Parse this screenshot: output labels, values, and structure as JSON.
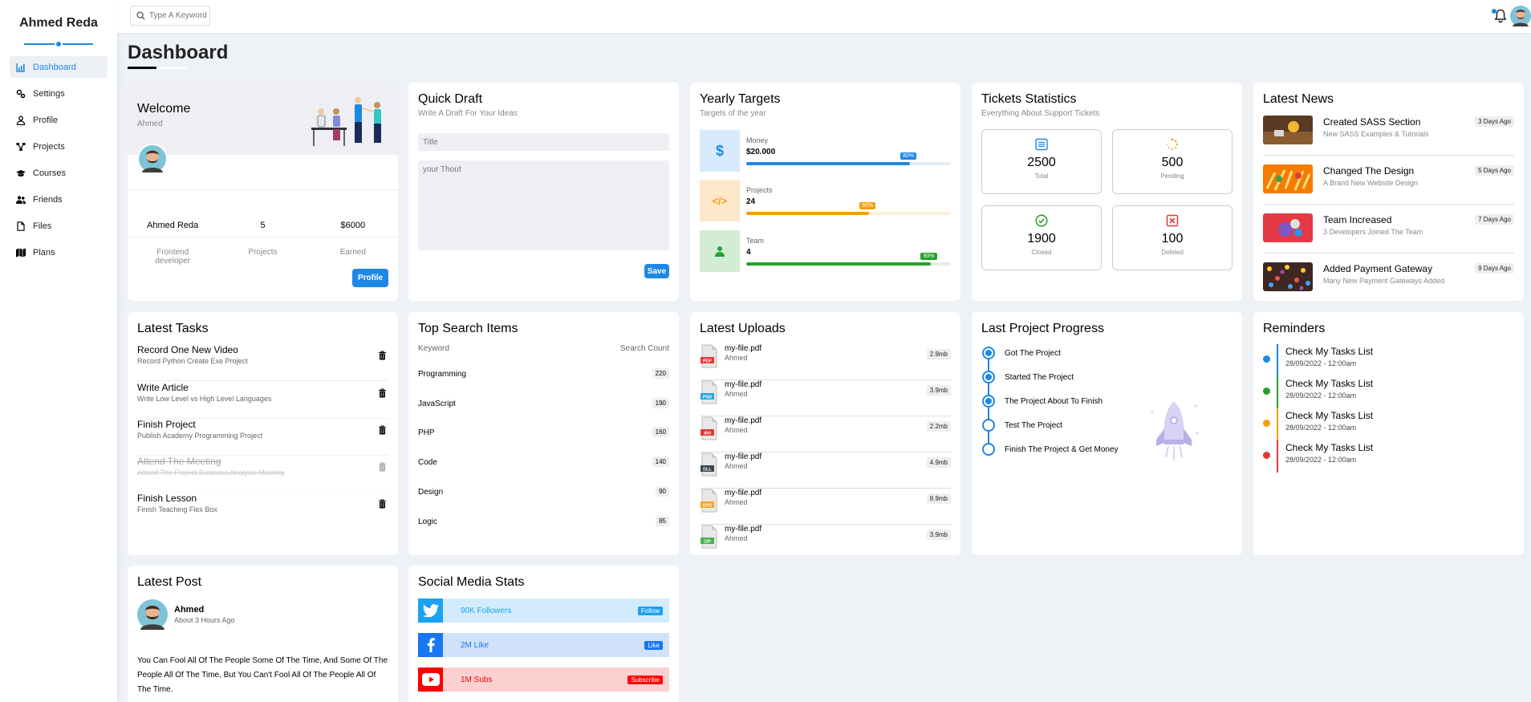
{
  "sidebar": {
    "brand": "Ahmed Reda",
    "items": [
      {
        "label": "Dashboard",
        "icon": "chart-icon"
      },
      {
        "label": "Settings",
        "icon": "gears-icon"
      },
      {
        "label": "Profile",
        "icon": "user-icon"
      },
      {
        "label": "Projects",
        "icon": "diagram-icon"
      },
      {
        "label": "Courses",
        "icon": "graduation-cap-icon"
      },
      {
        "label": "Friends",
        "icon": "users-icon"
      },
      {
        "label": "Files",
        "icon": "file-icon"
      },
      {
        "label": "Plans",
        "icon": "map-icon"
      }
    ]
  },
  "topbar": {
    "search_placeholder": "Type A Keyword"
  },
  "page": {
    "title": "Dashboard"
  },
  "welcome": {
    "title": "Welcome",
    "name": "Ahmed",
    "stats": [
      {
        "value": "Ahmed Reda",
        "label": "Frontend developer"
      },
      {
        "value": "5",
        "label": "Projects"
      },
      {
        "value": "$6000",
        "label": "Earned"
      }
    ],
    "button": "Profile"
  },
  "draft": {
    "title": "Quick Draft",
    "subtitle": "Write A Draft For Your Ideas",
    "title_placeholder": "Title",
    "body_placeholder": "your Thout",
    "button": "Save"
  },
  "targets": {
    "title": "Yearly Targets",
    "subtitle": "Targets of the year",
    "items": [
      {
        "label": "Money",
        "value": "$20.000",
        "percent": 80,
        "pct_label": "80%",
        "color": "#1e88e5",
        "bg": "#d8ebfc",
        "track": "#e3eef9"
      },
      {
        "label": "Projects",
        "value": "24",
        "percent": 60,
        "pct_label": "60%",
        "color": "#f59e0b",
        "bg": "#fde8cc",
        "track": "#fdf0da"
      },
      {
        "label": "Team",
        "value": "4",
        "percent": 90,
        "pct_label": "90%",
        "color": "#22a32c",
        "bg": "#d3ecd4",
        "track": "#e0f1e1"
      }
    ]
  },
  "tickets": {
    "title": "Tickets Statistics",
    "subtitle": "Everything About Support Tickets",
    "items": [
      {
        "value": "2500",
        "label": "Total"
      },
      {
        "value": "500",
        "label": "Pending"
      },
      {
        "value": "1900",
        "label": "Closed"
      },
      {
        "value": "100",
        "label": "Deleted"
      }
    ]
  },
  "news": {
    "title": "Latest News",
    "items": [
      {
        "title": "Created SASS Section",
        "desc": "New SASS Examples & Tutorials",
        "ago": "3 Days Ago"
      },
      {
        "title": "Changed The Design",
        "desc": "A Brand New Website Design",
        "ago": "5 Days Ago"
      },
      {
        "title": "Team Increased",
        "desc": "3 Developers Joined The Team",
        "ago": "7 Days Ago"
      },
      {
        "title": "Added Payment Gateway",
        "desc": "Many New Payment Gateways Added",
        "ago": "9 Days Ago"
      }
    ]
  },
  "tasks": {
    "title": "Latest Tasks",
    "items": [
      {
        "title": "Record One New Video",
        "desc": "Record Python Create Exe Project"
      },
      {
        "title": "Write Article",
        "desc": "Write Low Level vs High Level Languages"
      },
      {
        "title": "Finish Project",
        "desc": "Publish Academy Programming Project"
      },
      {
        "title": "Attend The Meeting",
        "desc": "Attend The Project Business Analysis Meeting"
      },
      {
        "title": "Finish Lesson",
        "desc": "Finish Teaching Flex Box"
      }
    ]
  },
  "search_items": {
    "title": "Top Search Items",
    "col_keyword": "Keyword",
    "col_count": "Search Count",
    "rows": [
      {
        "keyword": "Programming",
        "count": "220"
      },
      {
        "keyword": "JavaScript",
        "count": "190"
      },
      {
        "keyword": "PHP",
        "count": "160"
      },
      {
        "keyword": "Code",
        "count": "140"
      },
      {
        "keyword": "Design",
        "count": "90"
      },
      {
        "keyword": "Logic",
        "count": "85"
      }
    ]
  },
  "uploads": {
    "title": "Latest Uploads",
    "items": [
      {
        "name": "my-file.pdf",
        "author": "Ahmed",
        "size": "2.9mb",
        "type": "PDF",
        "color": "#e53935"
      },
      {
        "name": "my-file.pdf",
        "author": "Ahmed",
        "size": "3.9mb",
        "type": "PSD",
        "color": "#29a3e0"
      },
      {
        "name": "my-file.pdf",
        "author": "Ahmed",
        "size": "2.2mb",
        "type": "AVI",
        "color": "#e53935"
      },
      {
        "name": "my-file.pdf",
        "author": "Ahmed",
        "size": "4.9mb",
        "type": "DLL",
        "color": "#37474f"
      },
      {
        "name": "my-file.pdf",
        "author": "Ahmed",
        "size": "8.9mb",
        "type": "EPS",
        "color": "#f5a623"
      },
      {
        "name": "my-file.pdf",
        "author": "Ahmed",
        "size": "3.9mb",
        "type": "ZIP",
        "color": "#4caf50"
      }
    ]
  },
  "progress": {
    "title": "Last Project Progress",
    "steps": [
      {
        "label": "Got The Project",
        "done": true
      },
      {
        "label": "Started The Project",
        "done": true
      },
      {
        "label": "The Project About To Finish",
        "done": true
      },
      {
        "label": "Test The Project",
        "done": false
      },
      {
        "label": "Finish The Project & Get Money",
        "done": false
      }
    ]
  },
  "reminders": {
    "title": "Reminders",
    "items": [
      {
        "title": "Check My Tasks List",
        "date": "28/09/2022 - 12:00am",
        "color": "#1e88e5"
      },
      {
        "title": "Check My Tasks List",
        "date": "28/09/2022 - 12:00am",
        "color": "#22a32c"
      },
      {
        "title": "Check My Tasks List",
        "date": "28/09/2022 - 12:00am",
        "color": "#f59e0b"
      },
      {
        "title": "Check My Tasks List",
        "date": "28/09/2022 - 12:00am",
        "color": "#e53935"
      }
    ]
  },
  "post": {
    "title": "Latest Post",
    "author": "Ahmed",
    "time": "About 3 Hours Ago",
    "text": "You Can Fool All Of The People Some Of The Time, And Some Of The People All Of The Time, But You Can't Fool All Of The People All Of The Time."
  },
  "social": {
    "title": "Social Media Stats",
    "items": [
      {
        "label": "90K Followers",
        "button": "Follow",
        "icon": "twitter-icon",
        "color": "#1da1f2",
        "bg": "#d3ecfb"
      },
      {
        "label": "2M Like",
        "button": "Like",
        "icon": "facebook-icon",
        "color": "#1877f2",
        "bg": "#d0e2f9"
      },
      {
        "label": "1M Subs",
        "button": "Subscribe",
        "icon": "youtube-icon",
        "color": "#ff0000",
        "bg": "#fcd0d0"
      }
    ]
  }
}
